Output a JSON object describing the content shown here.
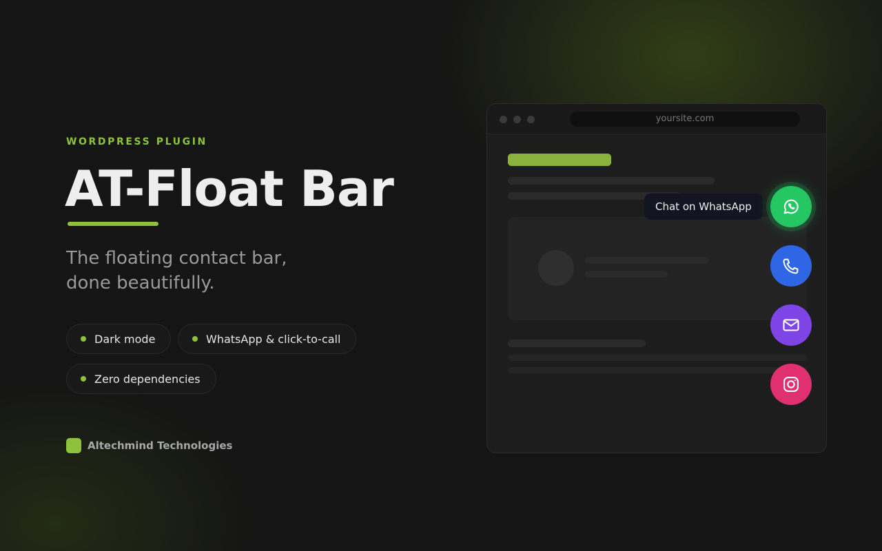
{
  "hero": {
    "eyebrow": "WORDPRESS PLUGIN",
    "title": "AT-Float Bar",
    "tagline_line1": "The floating contact bar,",
    "tagline_line2": "done beautifully.",
    "accent_color": "#8fc23c"
  },
  "features": [
    {
      "label": "Dark mode"
    },
    {
      "label": "WhatsApp & click-to-call"
    },
    {
      "label": "Zero dependencies"
    }
  ],
  "brand": {
    "name": "Altechmind Technologies"
  },
  "browser": {
    "url": "yoursite.com"
  },
  "float_bar": {
    "tooltip": "Chat on WhatsApp",
    "buttons": [
      {
        "name": "whatsapp",
        "icon": "whatsapp-icon",
        "color": "#25c763"
      },
      {
        "name": "call",
        "icon": "phone-icon",
        "color": "#2f66e6"
      },
      {
        "name": "email",
        "icon": "mail-icon",
        "color": "#7e44e6"
      },
      {
        "name": "instagram",
        "icon": "instagram-icon",
        "color": "#e0306f"
      }
    ]
  }
}
